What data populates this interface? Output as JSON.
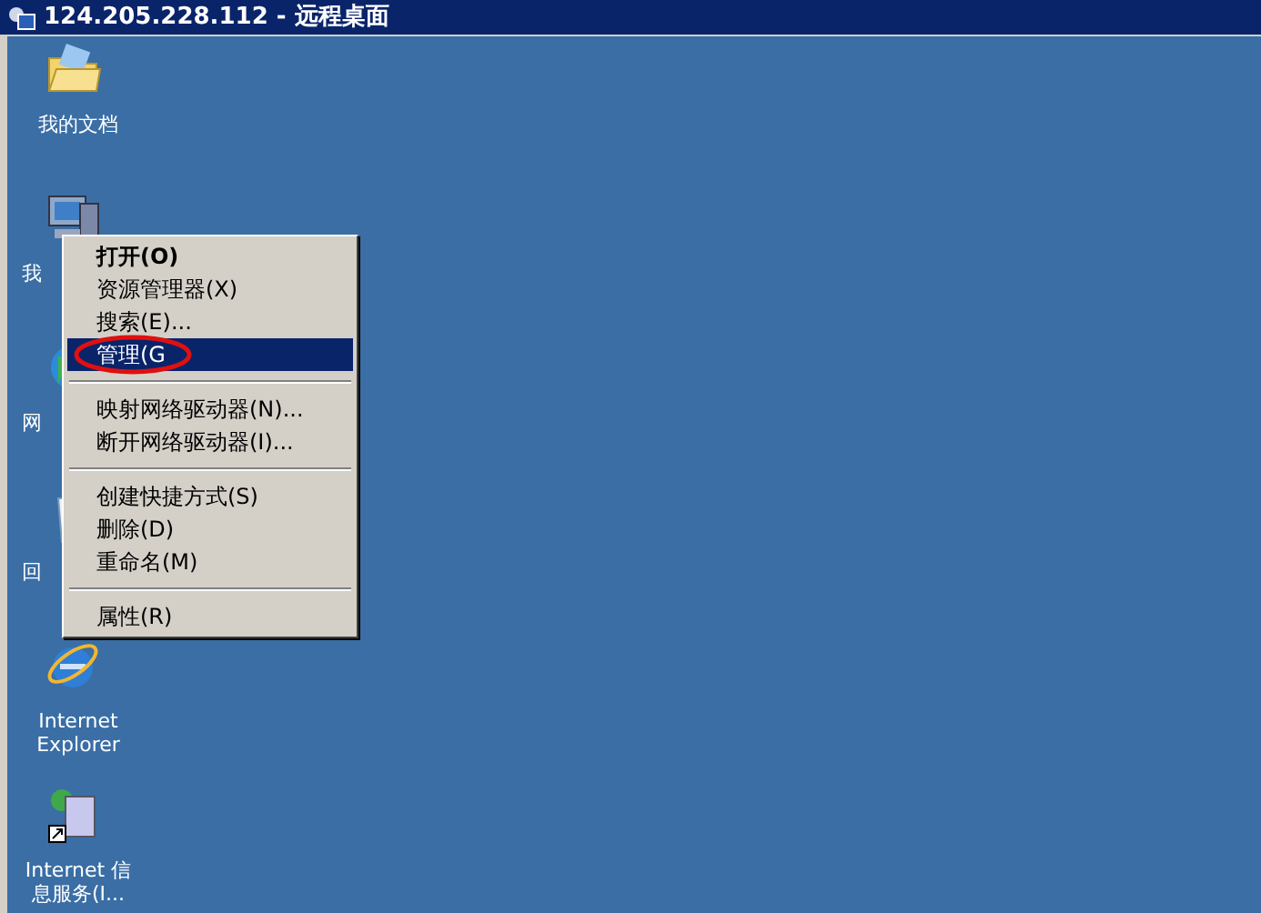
{
  "window": {
    "title": "124.205.228.112 - 远程桌面"
  },
  "desktop_icons": [
    {
      "kind": "folder",
      "label": "我的文档"
    },
    {
      "kind": "computer",
      "label": "我"
    },
    {
      "kind": "globe",
      "label": "网"
    },
    {
      "kind": "bin",
      "label": "回"
    },
    {
      "kind": "ie",
      "label": "Internet Explorer"
    },
    {
      "kind": "server",
      "label": "Internet 信息服务(I..."
    }
  ],
  "context_menu": [
    {
      "kind": "item",
      "label": "打开(O)",
      "default": true,
      "selected": false,
      "circled": false
    },
    {
      "kind": "item",
      "label": "资源管理器(X)",
      "default": false,
      "selected": false,
      "circled": false
    },
    {
      "kind": "item",
      "label": "搜索(E)...",
      "default": false,
      "selected": false,
      "circled": false
    },
    {
      "kind": "item",
      "label": "管理(G",
      "default": false,
      "selected": true,
      "circled": true
    },
    {
      "kind": "separator"
    },
    {
      "kind": "item",
      "label": "映射网络驱动器(N)...",
      "default": false,
      "selected": false,
      "circled": false
    },
    {
      "kind": "item",
      "label": "断开网络驱动器(I)...",
      "default": false,
      "selected": false,
      "circled": false
    },
    {
      "kind": "separator"
    },
    {
      "kind": "item",
      "label": "创建快捷方式(S)",
      "default": false,
      "selected": false,
      "circled": false
    },
    {
      "kind": "item",
      "label": "删除(D)",
      "default": false,
      "selected": false,
      "circled": false
    },
    {
      "kind": "item",
      "label": "重命名(M)",
      "default": false,
      "selected": false,
      "circled": false
    },
    {
      "kind": "separator"
    },
    {
      "kind": "item",
      "label": "属性(R)",
      "default": false,
      "selected": false,
      "circled": false
    }
  ]
}
